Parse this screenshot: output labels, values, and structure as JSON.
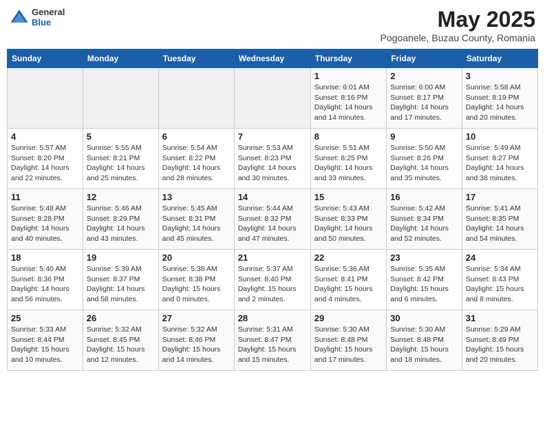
{
  "header": {
    "logo_general": "General",
    "logo_blue": "Blue",
    "month": "May 2025",
    "location": "Pogoanele, Buzau County, Romania"
  },
  "days_of_week": [
    "Sunday",
    "Monday",
    "Tuesday",
    "Wednesday",
    "Thursday",
    "Friday",
    "Saturday"
  ],
  "weeks": [
    [
      {
        "day": "",
        "content": ""
      },
      {
        "day": "",
        "content": ""
      },
      {
        "day": "",
        "content": ""
      },
      {
        "day": "",
        "content": ""
      },
      {
        "day": "1",
        "content": "Sunrise: 6:01 AM\nSunset: 8:16 PM\nDaylight: 14 hours\nand 14 minutes."
      },
      {
        "day": "2",
        "content": "Sunrise: 6:00 AM\nSunset: 8:17 PM\nDaylight: 14 hours\nand 17 minutes."
      },
      {
        "day": "3",
        "content": "Sunrise: 5:58 AM\nSunset: 8:19 PM\nDaylight: 14 hours\nand 20 minutes."
      }
    ],
    [
      {
        "day": "4",
        "content": "Sunrise: 5:57 AM\nSunset: 8:20 PM\nDaylight: 14 hours\nand 22 minutes."
      },
      {
        "day": "5",
        "content": "Sunrise: 5:55 AM\nSunset: 8:21 PM\nDaylight: 14 hours\nand 25 minutes."
      },
      {
        "day": "6",
        "content": "Sunrise: 5:54 AM\nSunset: 8:22 PM\nDaylight: 14 hours\nand 28 minutes."
      },
      {
        "day": "7",
        "content": "Sunrise: 5:53 AM\nSunset: 8:23 PM\nDaylight: 14 hours\nand 30 minutes."
      },
      {
        "day": "8",
        "content": "Sunrise: 5:51 AM\nSunset: 8:25 PM\nDaylight: 14 hours\nand 33 minutes."
      },
      {
        "day": "9",
        "content": "Sunrise: 5:50 AM\nSunset: 8:26 PM\nDaylight: 14 hours\nand 35 minutes."
      },
      {
        "day": "10",
        "content": "Sunrise: 5:49 AM\nSunset: 8:27 PM\nDaylight: 14 hours\nand 38 minutes."
      }
    ],
    [
      {
        "day": "11",
        "content": "Sunrise: 5:48 AM\nSunset: 8:28 PM\nDaylight: 14 hours\nand 40 minutes."
      },
      {
        "day": "12",
        "content": "Sunrise: 5:46 AM\nSunset: 8:29 PM\nDaylight: 14 hours\nand 43 minutes."
      },
      {
        "day": "13",
        "content": "Sunrise: 5:45 AM\nSunset: 8:31 PM\nDaylight: 14 hours\nand 45 minutes."
      },
      {
        "day": "14",
        "content": "Sunrise: 5:44 AM\nSunset: 8:32 PM\nDaylight: 14 hours\nand 47 minutes."
      },
      {
        "day": "15",
        "content": "Sunrise: 5:43 AM\nSunset: 8:33 PM\nDaylight: 14 hours\nand 50 minutes."
      },
      {
        "day": "16",
        "content": "Sunrise: 5:42 AM\nSunset: 8:34 PM\nDaylight: 14 hours\nand 52 minutes."
      },
      {
        "day": "17",
        "content": "Sunrise: 5:41 AM\nSunset: 8:35 PM\nDaylight: 14 hours\nand 54 minutes."
      }
    ],
    [
      {
        "day": "18",
        "content": "Sunrise: 5:40 AM\nSunset: 8:36 PM\nDaylight: 14 hours\nand 56 minutes."
      },
      {
        "day": "19",
        "content": "Sunrise: 5:39 AM\nSunset: 8:37 PM\nDaylight: 14 hours\nand 58 minutes."
      },
      {
        "day": "20",
        "content": "Sunrise: 5:38 AM\nSunset: 8:38 PM\nDaylight: 15 hours\nand 0 minutes."
      },
      {
        "day": "21",
        "content": "Sunrise: 5:37 AM\nSunset: 8:40 PM\nDaylight: 15 hours\nand 2 minutes."
      },
      {
        "day": "22",
        "content": "Sunrise: 5:36 AM\nSunset: 8:41 PM\nDaylight: 15 hours\nand 4 minutes."
      },
      {
        "day": "23",
        "content": "Sunrise: 5:35 AM\nSunset: 8:42 PM\nDaylight: 15 hours\nand 6 minutes."
      },
      {
        "day": "24",
        "content": "Sunrise: 5:34 AM\nSunset: 8:43 PM\nDaylight: 15 hours\nand 8 minutes."
      }
    ],
    [
      {
        "day": "25",
        "content": "Sunrise: 5:33 AM\nSunset: 8:44 PM\nDaylight: 15 hours\nand 10 minutes."
      },
      {
        "day": "26",
        "content": "Sunrise: 5:32 AM\nSunset: 8:45 PM\nDaylight: 15 hours\nand 12 minutes."
      },
      {
        "day": "27",
        "content": "Sunrise: 5:32 AM\nSunset: 8:46 PM\nDaylight: 15 hours\nand 14 minutes."
      },
      {
        "day": "28",
        "content": "Sunrise: 5:31 AM\nSunset: 8:47 PM\nDaylight: 15 hours\nand 15 minutes."
      },
      {
        "day": "29",
        "content": "Sunrise: 5:30 AM\nSunset: 8:48 PM\nDaylight: 15 hours\nand 17 minutes."
      },
      {
        "day": "30",
        "content": "Sunrise: 5:30 AM\nSunset: 8:48 PM\nDaylight: 15 hours\nand 18 minutes."
      },
      {
        "day": "31",
        "content": "Sunrise: 5:29 AM\nSunset: 8:49 PM\nDaylight: 15 hours\nand 20 minutes."
      }
    ]
  ]
}
